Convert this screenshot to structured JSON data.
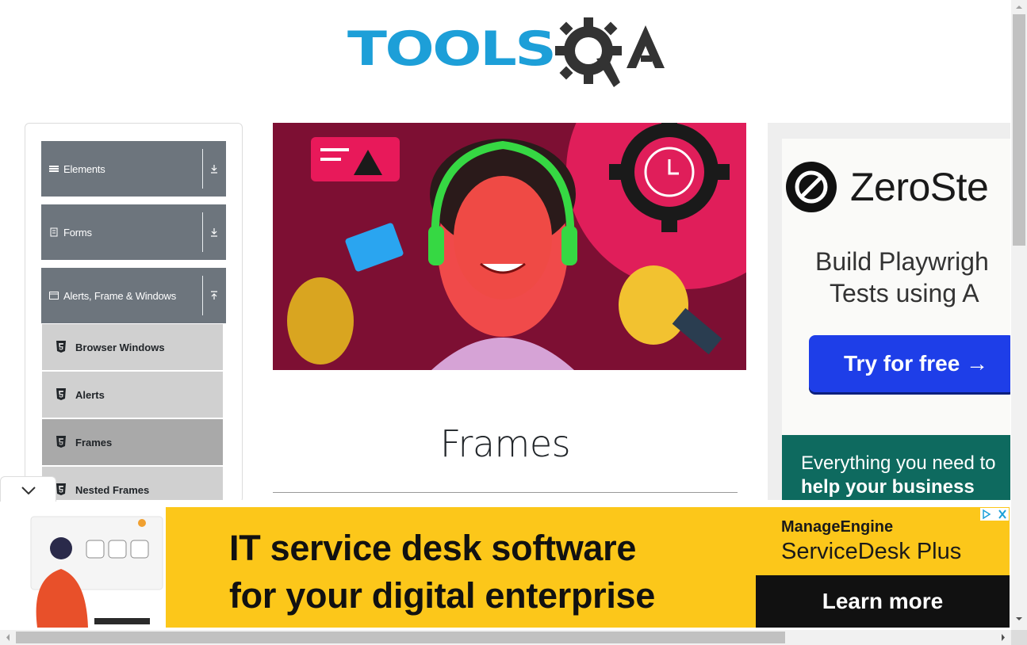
{
  "header": {
    "logo_text": "TOOLSQA"
  },
  "sidebar": {
    "groups": [
      {
        "label": "Elements",
        "icon": "list-icon",
        "arrow": "expand-icon"
      },
      {
        "label": "Forms",
        "icon": "form-icon",
        "arrow": "expand-icon"
      },
      {
        "label": "Alerts, Frame & Windows",
        "icon": "window-icon",
        "arrow": "collapse-icon"
      }
    ],
    "items": [
      {
        "label": "Browser Windows",
        "icon": "html5-icon"
      },
      {
        "label": "Alerts",
        "icon": "html5-icon"
      },
      {
        "label": "Frames",
        "icon": "html5-icon",
        "active": true
      },
      {
        "label": "Nested Frames",
        "icon": "html5-icon"
      }
    ]
  },
  "main": {
    "title": "Frames"
  },
  "right_ad": {
    "brand": "ZeroSte",
    "headline_line1": "Build Playwrigh",
    "headline_line2": "Tests using A",
    "cta": "Try for free →",
    "footer_line1": "Everything you need to",
    "footer_line2": "help your business"
  },
  "bottom_ad": {
    "headline_line1": "IT service desk software",
    "headline_line2": "for your digital enterprise",
    "brand": "ManageEngine",
    "product": "ServiceDesk Plus",
    "cta": "Learn more"
  },
  "colors": {
    "logo_blue": "#1d9fd8",
    "sidebar_header": "#6d757d",
    "sidebar_item": "#d0d0d0",
    "sidebar_item_active": "#a9a9a9",
    "ad_yellow": "#fcc71a",
    "zs_blue": "#1e3ee8",
    "zs_green": "#0e6a5f"
  }
}
